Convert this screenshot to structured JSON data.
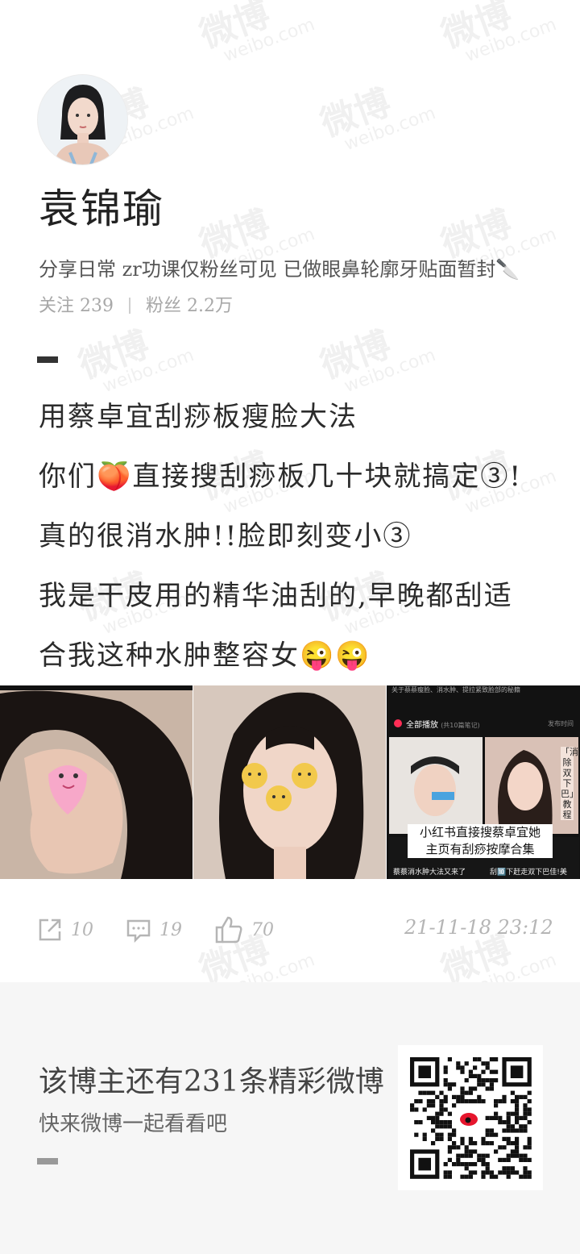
{
  "watermark": {
    "cn": "微博",
    "en": "weibo.com"
  },
  "profile": {
    "name": "袁锦瑜",
    "bio": "分享日常 zr功课仅粉丝可见 已做眼鼻轮廓牙贴面暂封🔪",
    "follow_label": "关注",
    "follow_count": "239",
    "fans_label": "粉丝",
    "fans_count": "2.2万"
  },
  "post": {
    "lines": [
      "用蔡卓宜刮痧板瘦脸大法",
      "你们🍑直接搜刮痧板几十块就搞定③!",
      "真的很消水肿!!脸即刻变小③",
      "我是干皮用的精华油刮的,早晚都刮适",
      "合我这种水肿整容女😜😜"
    ]
  },
  "images": {
    "third": {
      "header_text": "关于蔡蔡瘦脸、消水肿、提拉紧致脸部的秘籍",
      "play_all": "全部播放",
      "play_count": "(共10篇笔记)",
      "sort": "发布时间",
      "overlay_line1": "小红书直接搜蔡卓宜她",
      "overlay_line2": "主页有刮痧按摩合集",
      "side_text": "「消除双下巴」教程",
      "caption_left": "蔡蔡消水肿大法又来了",
      "caption_right": "刮🔟下赶走双下巴佳!美"
    }
  },
  "actions": {
    "repost": "10",
    "comment": "19",
    "like": "70",
    "date": "21-11-18 23:12"
  },
  "footer": {
    "title": "该博主还有231条精彩微博",
    "subtitle": "快来微博一起看看吧"
  }
}
